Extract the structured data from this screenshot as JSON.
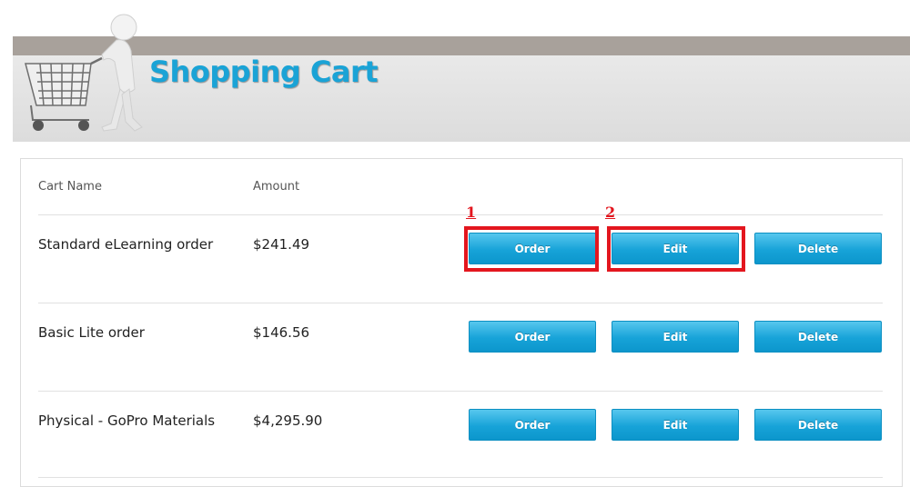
{
  "header": {
    "title": "Shopping Cart",
    "logo_icon": "shopping-cart-figure-icon"
  },
  "columns": {
    "cart_name": "Cart Name",
    "amount": "Amount"
  },
  "rows": [
    {
      "name": "Standard eLearning order",
      "amount": "$241.49"
    },
    {
      "name": "Basic Lite order",
      "amount": "$146.56"
    },
    {
      "name": "Physical - GoPro Materials",
      "amount": "$4,295.90"
    }
  ],
  "actions": {
    "order": "Order",
    "edit": "Edit",
    "delete": "Delete"
  },
  "annotations": [
    {
      "label": "1",
      "target": "Order"
    },
    {
      "label": "2",
      "target": "Edit"
    }
  ],
  "colors": {
    "accent": "#1aa3d6",
    "button": "#17a3d8",
    "highlight": "#e3161e"
  }
}
